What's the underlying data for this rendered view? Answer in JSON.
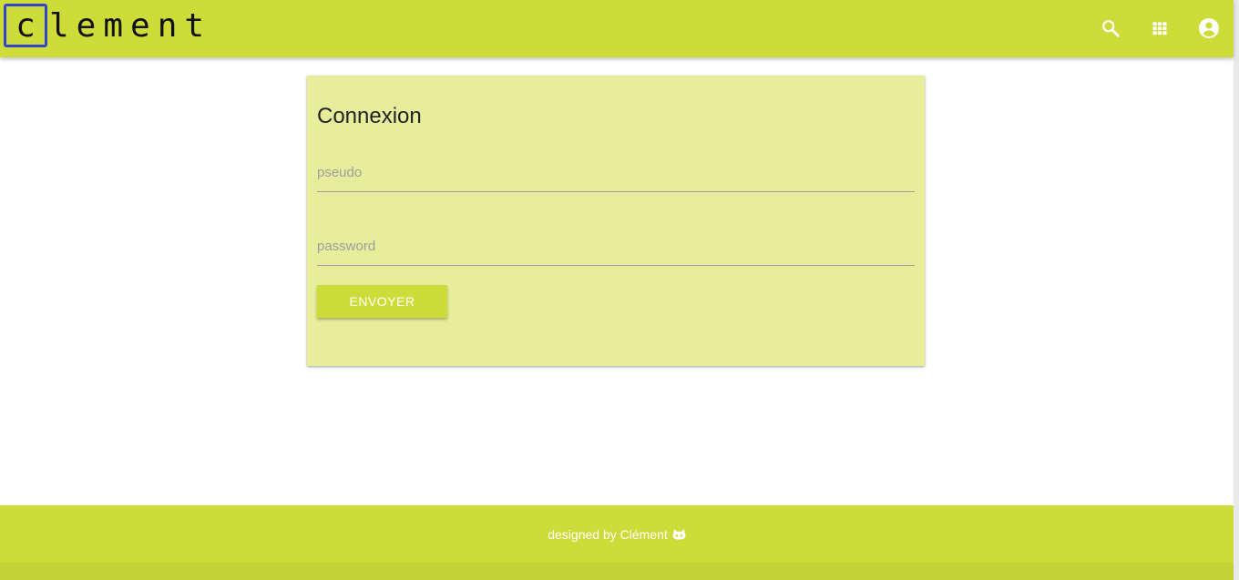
{
  "header": {
    "logo_first_letter": "c",
    "logo_rest": "lement",
    "icons": [
      "search-icon",
      "apps-grid-icon",
      "account-circle-icon"
    ]
  },
  "login": {
    "title": "Connexion",
    "pseudo_placeholder": "pseudo",
    "password_placeholder": "password",
    "submit_label": "ENVOYER"
  },
  "footer": {
    "text": "designed by Clément",
    "icon": "github-icon"
  },
  "colors": {
    "primary": "#cddc39",
    "card_background": "#e6ee9c",
    "logo_box_border": "#3344cc"
  }
}
